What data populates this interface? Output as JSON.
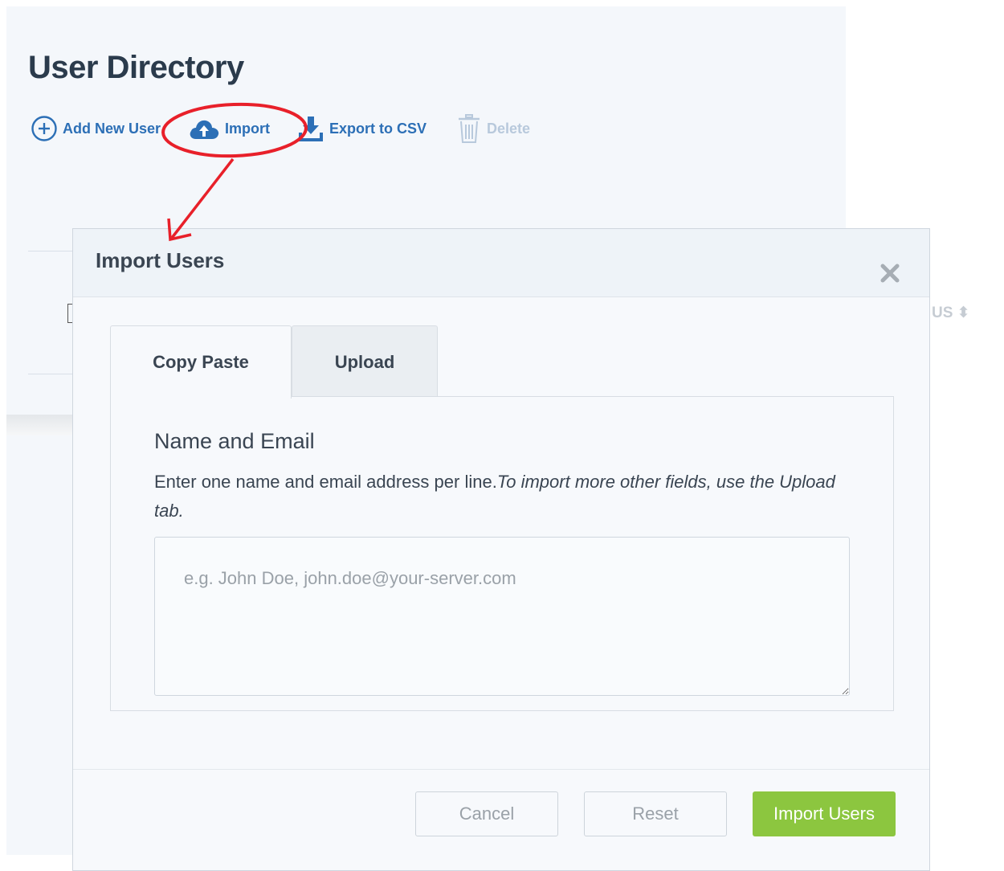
{
  "page": {
    "title": "User Directory"
  },
  "toolbar": {
    "add_label": "Add New User",
    "import_label": "Import",
    "export_label": "Export to CSV",
    "delete_label": "Delete"
  },
  "background": {
    "status_column_fragment": "US ⬍"
  },
  "modal": {
    "title": "Import Users",
    "tabs": [
      {
        "label": "Copy Paste",
        "active": true
      },
      {
        "label": "Upload",
        "active": false
      }
    ],
    "section_title": "Name and Email",
    "description_plain": "Enter one name and email address per line.",
    "description_italic": "To import more other fields, use the Upload tab.",
    "textarea": {
      "value": "",
      "placeholder": "e.g. John Doe, john.doe@your-server.com"
    },
    "buttons": {
      "cancel": "Cancel",
      "reset": "Reset",
      "import": "Import Users"
    }
  },
  "colors": {
    "link_blue": "#2c6fb6",
    "import_green": "#8cc63f",
    "annotation_red": "#e8202a"
  }
}
